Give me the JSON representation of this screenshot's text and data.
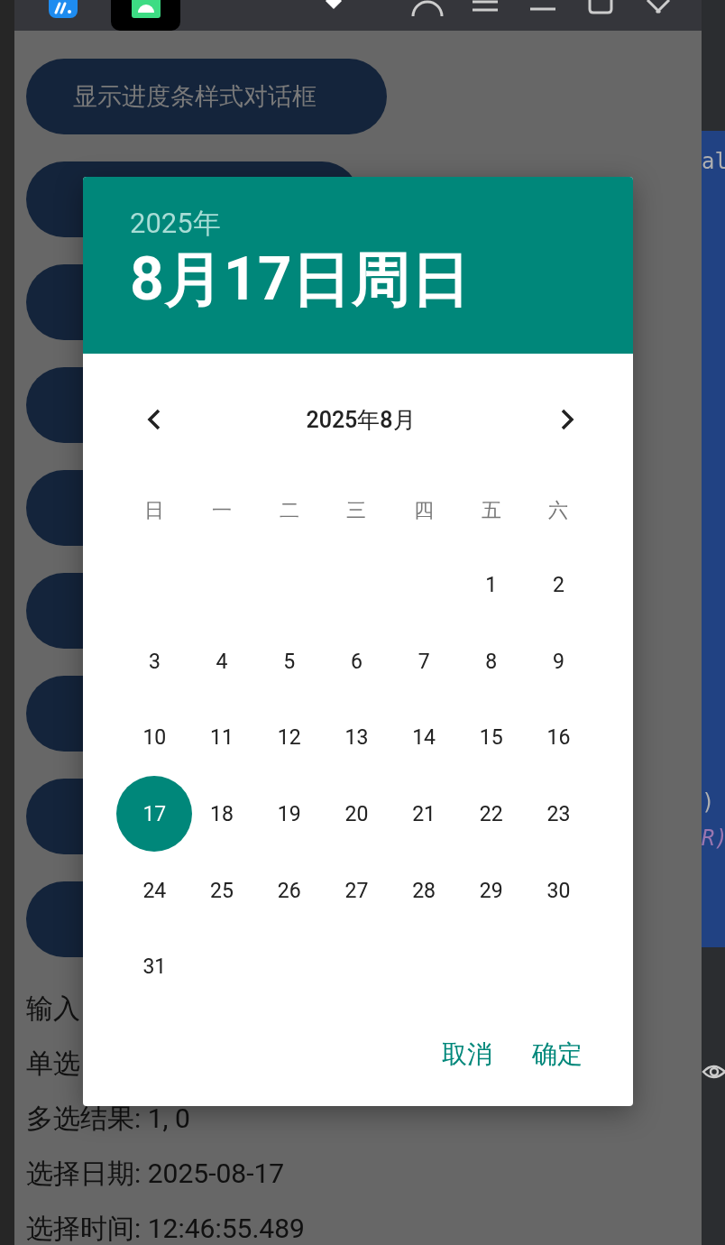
{
  "ide": {
    "right_code": [
      {
        "text": "al",
        "kind": "plain"
      },
      {
        "text": ")",
        "kind": "plain"
      },
      {
        "text": "R)",
        "kind": "keyword"
      }
    ]
  },
  "emulator": {
    "tabs": [
      {
        "kind": "app",
        "selected": false
      },
      {
        "kind": "android",
        "selected": true
      }
    ]
  },
  "buttons": [
    {
      "kind": "labeled",
      "label": "显示进度条样式对话框"
    },
    {
      "kind": "covered"
    },
    {
      "kind": "covered"
    },
    {
      "kind": "covered"
    },
    {
      "kind": "covered"
    },
    {
      "kind": "covered"
    },
    {
      "kind": "covered"
    },
    {
      "kind": "covered"
    },
    {
      "kind": "covered"
    }
  ],
  "results": [
    "输入",
    "单选",
    "多选结果: 1, 0",
    "选择日期: 2025-08-17",
    "选择时间: 12:46:55.489"
  ],
  "dialog": {
    "year": "2025年",
    "date": "8月17日周日",
    "month_title": "2025年8月",
    "weekdays": [
      "日",
      "一",
      "二",
      "三",
      "四",
      "五",
      "六"
    ],
    "weeks": [
      {
        "kind": "lead",
        "days": [
          {
            "label": "1",
            "selected": false
          },
          {
            "label": "2",
            "selected": false
          }
        ]
      },
      {
        "kind": "full",
        "days": [
          {
            "label": "3",
            "selected": false
          },
          {
            "label": "4",
            "selected": false
          },
          {
            "label": "5",
            "selected": false
          },
          {
            "label": "6",
            "selected": false
          },
          {
            "label": "7",
            "selected": false
          },
          {
            "label": "8",
            "selected": false
          },
          {
            "label": "9",
            "selected": false
          }
        ]
      },
      {
        "kind": "full",
        "days": [
          {
            "label": "10",
            "selected": false
          },
          {
            "label": "11",
            "selected": false
          },
          {
            "label": "12",
            "selected": false
          },
          {
            "label": "13",
            "selected": false
          },
          {
            "label": "14",
            "selected": false
          },
          {
            "label": "15",
            "selected": false
          },
          {
            "label": "16",
            "selected": false
          }
        ]
      },
      {
        "kind": "full",
        "days": [
          {
            "label": "17",
            "selected": true
          },
          {
            "label": "18",
            "selected": false
          },
          {
            "label": "19",
            "selected": false
          },
          {
            "label": "20",
            "selected": false
          },
          {
            "label": "21",
            "selected": false
          },
          {
            "label": "22",
            "selected": false
          },
          {
            "label": "23",
            "selected": false
          }
        ]
      },
      {
        "kind": "full",
        "days": [
          {
            "label": "24",
            "selected": false
          },
          {
            "label": "25",
            "selected": false
          },
          {
            "label": "26",
            "selected": false
          },
          {
            "label": "27",
            "selected": false
          },
          {
            "label": "28",
            "selected": false
          },
          {
            "label": "29",
            "selected": false
          },
          {
            "label": "30",
            "selected": false
          }
        ]
      },
      {
        "kind": "trail",
        "days": [
          {
            "label": "31",
            "selected": false
          }
        ]
      }
    ],
    "actions": [
      "取消",
      "确定"
    ]
  }
}
